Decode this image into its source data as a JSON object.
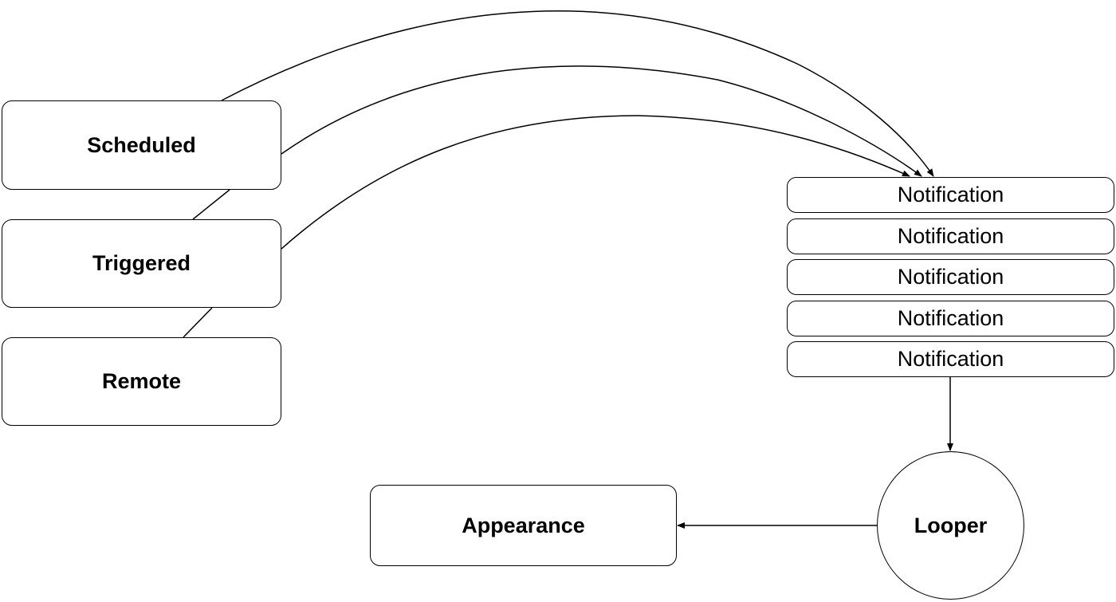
{
  "diagram": {
    "sources": [
      {
        "id": "scheduled",
        "label": "Scheduled"
      },
      {
        "id": "triggered",
        "label": "Triggered"
      },
      {
        "id": "remote",
        "label": "Remote"
      }
    ],
    "notifications": [
      {
        "label": "Notification"
      },
      {
        "label": "Notification"
      },
      {
        "label": "Notification"
      },
      {
        "label": "Notification"
      },
      {
        "label": "Notification"
      }
    ],
    "looper": {
      "label": "Looper"
    },
    "appearance": {
      "label": "Appearance"
    },
    "edges": [
      {
        "from": "scheduled",
        "to": "notification-queue",
        "arrow": true
      },
      {
        "from": "scheduled",
        "to": "notification-queue",
        "arrow": true
      },
      {
        "from": "triggered",
        "to": "notification-queue",
        "arrow": true
      },
      {
        "from": "scheduled",
        "to": "triggered",
        "arrow": false
      },
      {
        "from": "triggered",
        "to": "remote",
        "arrow": false
      },
      {
        "from": "notification-queue",
        "to": "looper",
        "arrow": true
      },
      {
        "from": "looper",
        "to": "appearance",
        "arrow": true
      }
    ],
    "colors": {
      "stroke": "#000000",
      "fill": "#ffffff",
      "text": "#000000"
    }
  }
}
